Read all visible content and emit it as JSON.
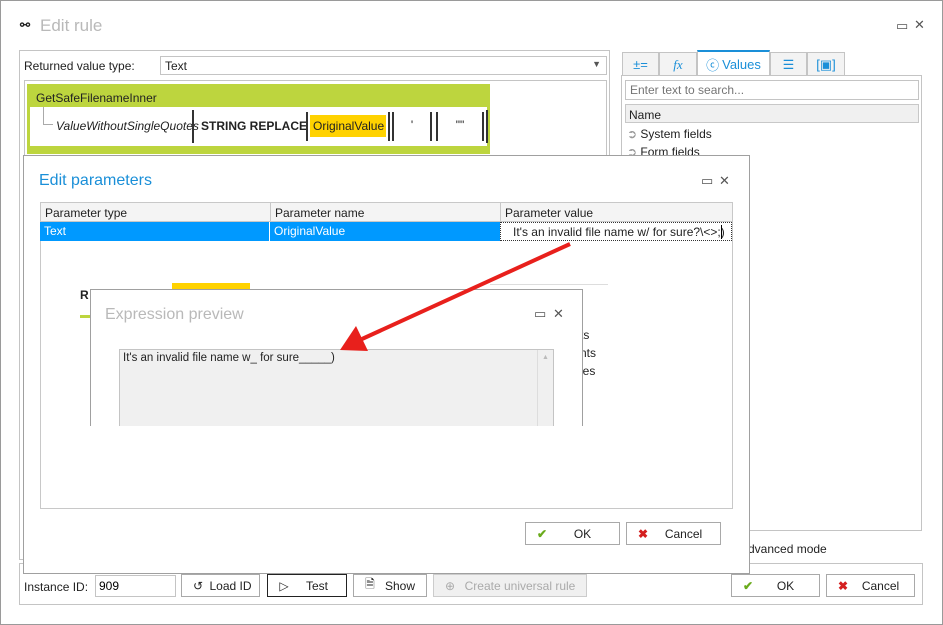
{
  "window": {
    "title": "Edit rule",
    "icon": "link-icon"
  },
  "left": {
    "returned_label": "Returned value type:",
    "returned_value": "Text"
  },
  "rule": {
    "name": "GetSafeFilenameInner",
    "variable": "ValueWithoutSingleQuotes",
    "function": "STRING REPLACE",
    "arg1": "OriginalValue",
    "arg2": "'",
    "arg3": "\"\""
  },
  "right": {
    "tabs": [
      {
        "icon": "operators-icon"
      },
      {
        "icon": "function-icon"
      },
      {
        "label": "Values",
        "icon": "values-icon"
      },
      {
        "icon": "list-icon"
      },
      {
        "icon": "bracket-icon"
      }
    ],
    "search_placeholder": "Enter text to search...",
    "column": "Name",
    "items": [
      "System fields",
      "Form fields"
    ],
    "fragments": [
      "ts",
      "nts",
      "les"
    ],
    "advanced_mode": "dvanced mode"
  },
  "bottom": {
    "instance_label": "Instance ID:",
    "instance_value": "909",
    "load_id": "Load ID",
    "test": "Test",
    "show": "Show",
    "create_universal": "Create universal rule",
    "ok": "OK",
    "cancel": "Cancel"
  },
  "edit_params": {
    "title": "Edit parameters",
    "headers": [
      "Parameter type",
      "Parameter name",
      "Parameter value"
    ],
    "row": [
      "Text",
      "OriginalValue",
      "It's an invalid file name w/ for sure?\\<>;)"
    ],
    "ok": "OK",
    "cancel": "Cancel",
    "fragment": "R"
  },
  "preview": {
    "title": "Expression preview",
    "text": "It's an invalid file name w_ for sure_____)"
  },
  "colors": {
    "accent": "#1a8fd8",
    "rule_green": "#bdd53e",
    "highlight": "#ffd200",
    "selection": "#0099ff",
    "arrow": "#e8201c"
  }
}
